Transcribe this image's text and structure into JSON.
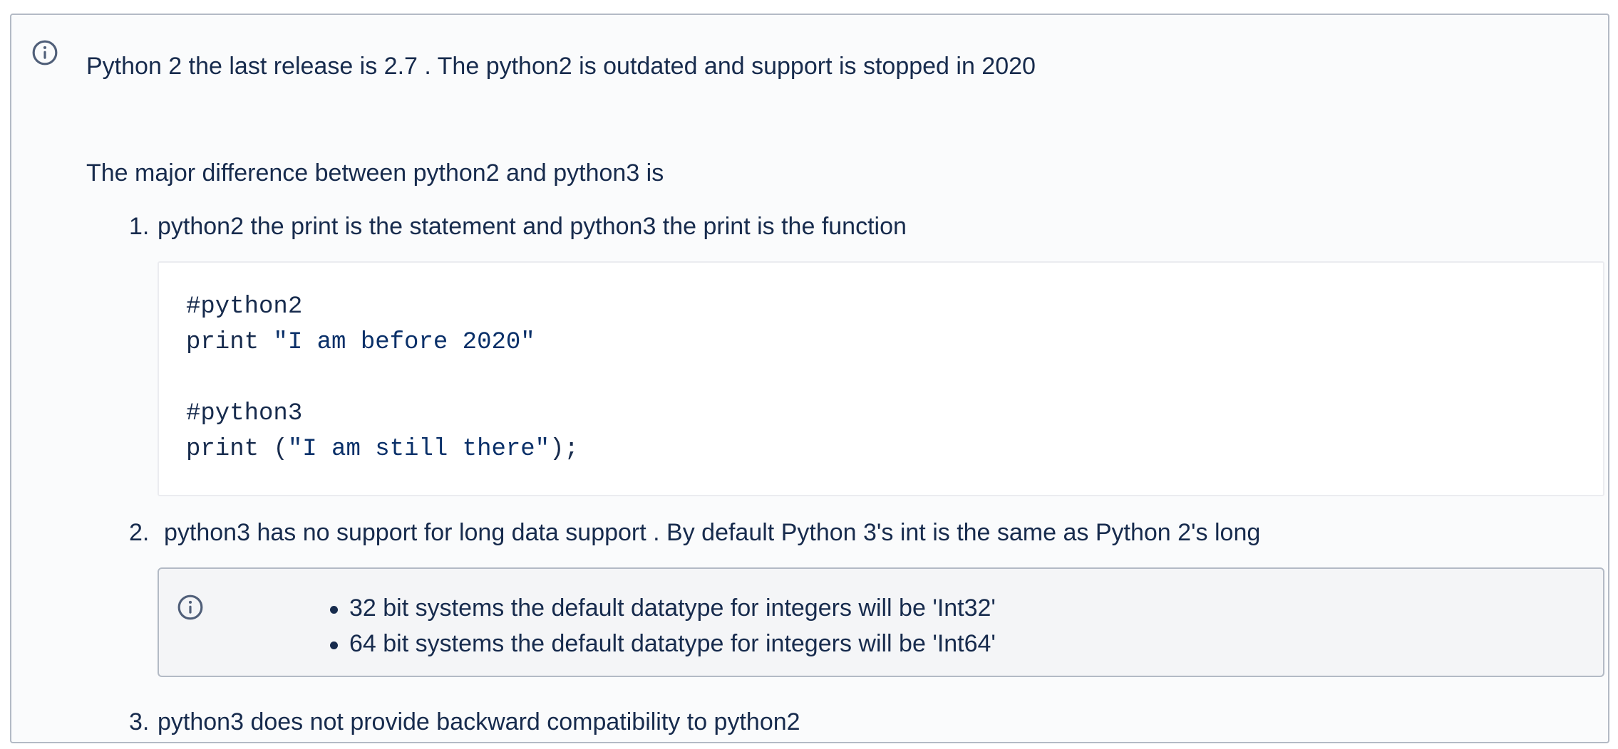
{
  "info_panel": {
    "icon": "info-icon",
    "intro": "Python 2 the last release is 2.7 . The python2 is outdated and support is stopped in 2020",
    "major_difference": "The major difference between python2 and python3 is",
    "items": [
      {
        "number": "1.",
        "text": "python2 the print is the statement and python3 the print is the function",
        "code": {
          "lines": [
            {
              "code": "#python2",
              "string": "",
              "suffix": ""
            },
            {
              "code": "print ",
              "string": "\"I am before 2020\"",
              "suffix": ""
            },
            {
              "code": "#python3",
              "string": "",
              "suffix": ""
            },
            {
              "code": "print (",
              "string": "\"I am still there\"",
              "suffix": ");"
            }
          ]
        }
      },
      {
        "number": "2.",
        "text": "python3 has no support for long data support . By default Python 3's int is the same as Python 2's long",
        "note": {
          "icon": "info-icon",
          "bullets": [
            "32 bit systems the default datatype for integers will be 'Int32'",
            "64 bit systems the default datatype for integers will be 'Int64'"
          ]
        }
      },
      {
        "number": "3.",
        "text": "python3 does not provide backward compatibility to python2"
      }
    ]
  },
  "colors": {
    "text": "#172b4d",
    "border": "#b3bac5",
    "panel_background": "#fafbfc",
    "code_string": "#0a3069"
  }
}
